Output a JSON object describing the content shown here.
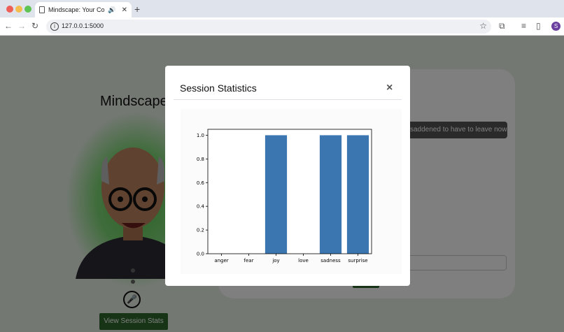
{
  "browser": {
    "tab_title": "Mindscape: Your Confide",
    "url": "127.0.0.1:5000",
    "profile_initial": "S"
  },
  "page": {
    "title": "Mindscape",
    "stats_button_label": "View Session Stats",
    "chat_message": "saddened to have to leave now."
  },
  "modal": {
    "title": "Session Statistics",
    "close_label": "×"
  },
  "colors": {
    "bar": "#3b76b0",
    "button": "#2f6b2d",
    "page_bg": "#e9f1e7"
  },
  "chart_data": {
    "type": "bar",
    "categories": [
      "anger",
      "fear",
      "joy",
      "love",
      "sadness",
      "surprise"
    ],
    "values": [
      0,
      0,
      1.0,
      0,
      1.0,
      1.0
    ],
    "ylim": [
      0,
      1.05
    ],
    "yticks": [
      "0.0",
      "0.2",
      "0.4",
      "0.6",
      "0.8",
      "1.0"
    ],
    "grid": false
  }
}
